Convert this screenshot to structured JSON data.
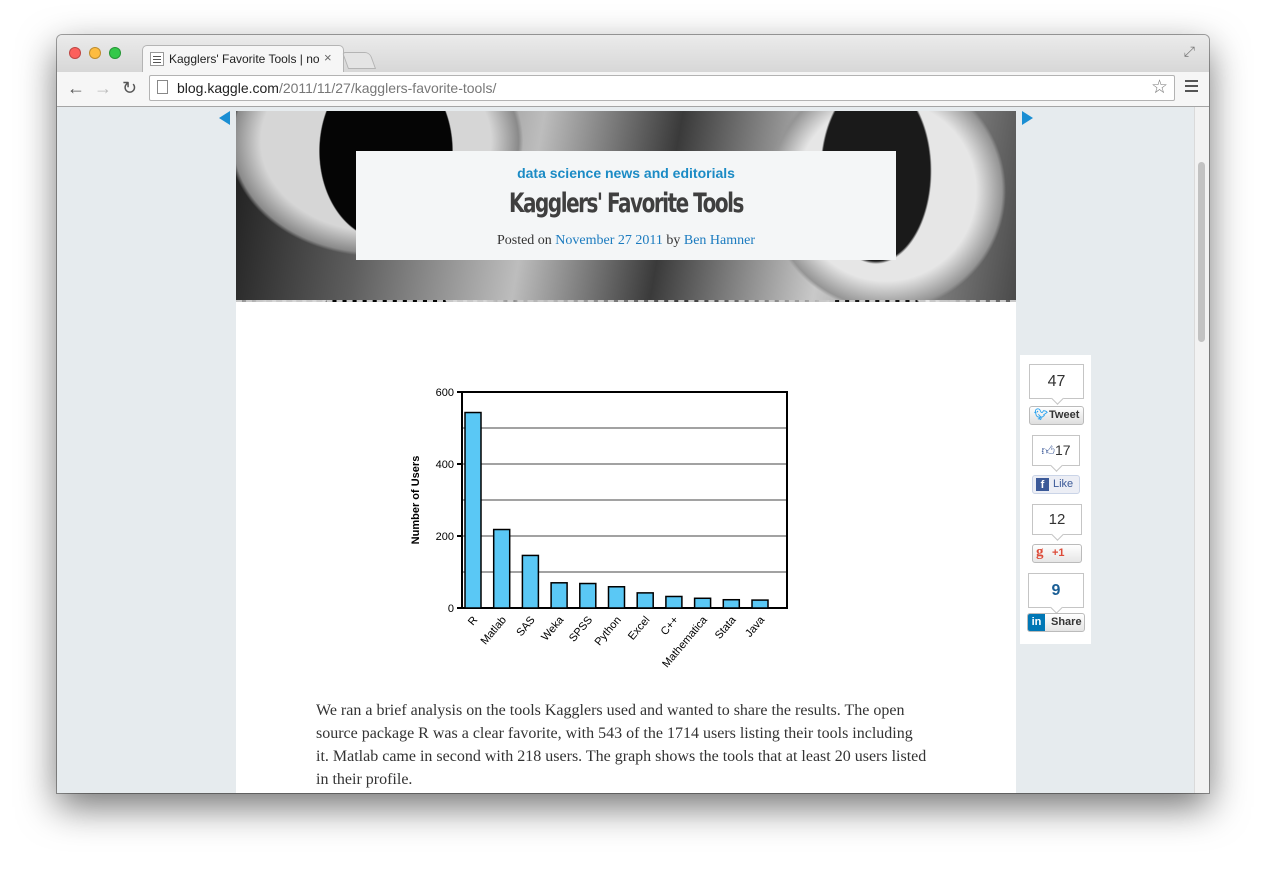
{
  "browser": {
    "tab_title": "Kagglers' Favorite Tools | no",
    "tab_close": "×",
    "url_host": "blog.kaggle.com",
    "url_path": "/2011/11/27/kagglers-favorite-tools/",
    "icons": [
      "back-icon",
      "forward-icon",
      "reload-icon",
      "star-icon",
      "menu-icon",
      "fullscreen-icon"
    ],
    "traffic_light_colors": [
      "#fc605c",
      "#fdbc40",
      "#34c84a"
    ]
  },
  "post": {
    "category": "data science news and editorials",
    "title": "Kagglers' Favorite Tools",
    "posted_on": "Posted on",
    "date": "November 27 2011",
    "by": "by",
    "author": "Ben Hamner",
    "body": "We ran a brief analysis on the tools Kagglers used and wanted to share the results.  The open source package R was a clear favorite, with 543 of the 1714 users listing their tools including it.  Matlab came in second with 218 users.  The graph shows the tools that at least 20 users listed in their profile."
  },
  "share": {
    "tweet_count": "47",
    "tweet_label": "Tweet",
    "like_count": "17",
    "like_label": "Like",
    "plus_count": "12",
    "plus_label": "+1",
    "linkedin_count": "9",
    "linkedin_label": "Share"
  },
  "colors": {
    "accent": "#1b8bc5",
    "bar_fill": "#5ac8f5"
  },
  "chart_data": {
    "type": "bar",
    "title": "",
    "xlabel": "",
    "ylabel": "Number of Users",
    "categories": [
      "R",
      "Matlab",
      "SAS",
      "Weka",
      "SPSS",
      "Python",
      "Excel",
      "C++",
      "Mathematica",
      "Stata",
      "Java"
    ],
    "values": [
      543,
      218,
      146,
      70,
      68,
      59,
      42,
      32,
      27,
      23,
      22
    ],
    "ylim": [
      0,
      600
    ],
    "yticks": [
      0,
      200,
      400,
      600
    ],
    "grid": true
  }
}
